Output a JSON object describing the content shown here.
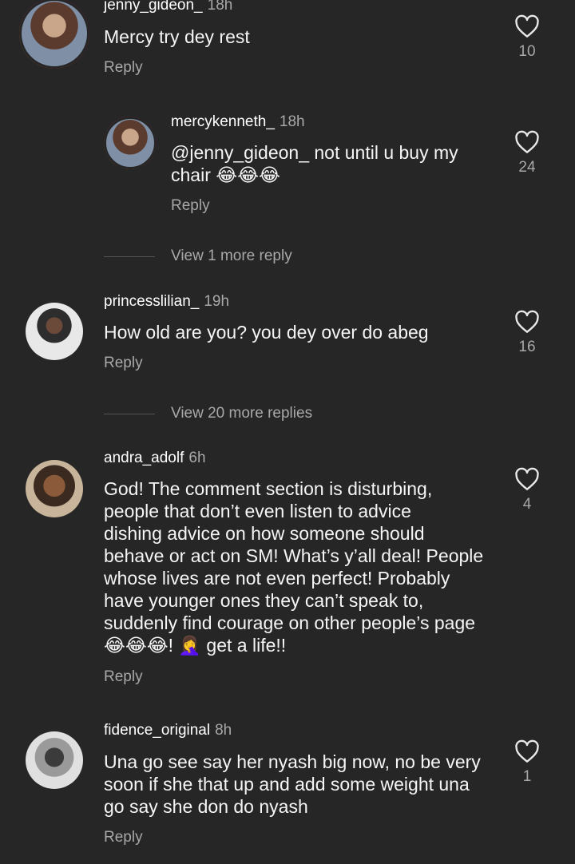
{
  "comments": [
    {
      "username": "jenny_gideon_",
      "time": "18h",
      "text": "Mercy try dey rest",
      "reply": "Reply",
      "likes": "10"
    },
    {
      "username": "mercykenneth_",
      "time": "18h",
      "text_line1": "@jenny_gideon_ not until u buy my",
      "text_line2": "chair 😂😂😂",
      "reply": "Reply",
      "likes": "24"
    },
    {
      "username": "princesslilian_",
      "time": "19h",
      "text": "How old are you? you dey over do abeg",
      "reply": "Reply",
      "likes": "16"
    },
    {
      "username": "andra_adolf",
      "time": "6h",
      "lines": [
        "God! The comment section is disturbing,",
        "people that don’t even listen to advice",
        "dishing advice on how someone should",
        "behave or act on SM! What’s y’all deal! People",
        "whose lives are not even perfect! Probably",
        "have younger ones they can’t speak to,",
        "suddenly find courage on other people’s page",
        "😂😂😂! 🤦‍♀️ get a life!!"
      ],
      "reply": "Reply",
      "likes": "4"
    },
    {
      "username": "fidence_original",
      "time": "8h",
      "lines": [
        "Una go see say her nyash big now, no be very",
        "soon if she that up and add some weight una",
        "go say she don do nyash"
      ],
      "reply": "Reply",
      "likes": "1"
    }
  ],
  "view_more": [
    {
      "label": "View 1 more reply"
    },
    {
      "label": "View 20 more replies"
    }
  ]
}
